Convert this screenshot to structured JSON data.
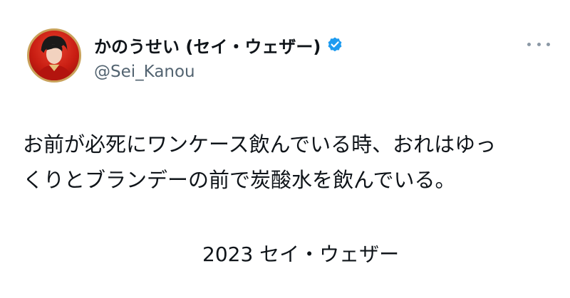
{
  "profile": {
    "display_name": "かのうせい (セイ・ウェザー)",
    "handle": "@Sei_Kanou",
    "verified": true,
    "avatar_icon": "avatar-photo",
    "verified_icon": "verified-badge-icon",
    "accent_color": "#1d9bf0"
  },
  "header": {
    "more_icon": "more-horizontal-icon"
  },
  "tweet": {
    "lines": [
      "お前が必死にワンケース飲んでいる時、おれはゆっ",
      "くりとブランデーの前で炭酸水を飲んでいる。"
    ],
    "signature": "2023 セイ・ウェザー"
  }
}
